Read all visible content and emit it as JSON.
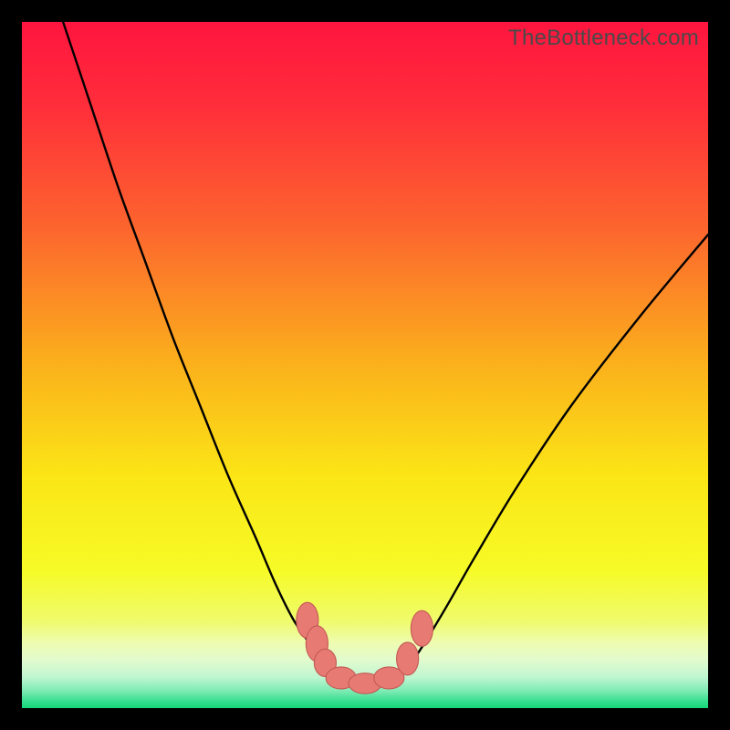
{
  "watermark": "TheBottleneck.com",
  "colors": {
    "frame": "#000000",
    "curve": "#000000",
    "marker_fill": "#e77b74",
    "marker_stroke": "#c45a55",
    "gradient_stops": [
      {
        "offset": 0.0,
        "color": "#ff153f"
      },
      {
        "offset": 0.12,
        "color": "#ff2d3a"
      },
      {
        "offset": 0.3,
        "color": "#fc652e"
      },
      {
        "offset": 0.5,
        "color": "#fbb11c"
      },
      {
        "offset": 0.66,
        "color": "#fbe516"
      },
      {
        "offset": 0.8,
        "color": "#f6fb27"
      },
      {
        "offset": 0.875,
        "color": "#effb6f"
      },
      {
        "offset": 0.905,
        "color": "#eefcb1"
      },
      {
        "offset": 0.93,
        "color": "#e2fbce"
      },
      {
        "offset": 0.955,
        "color": "#bff6d1"
      },
      {
        "offset": 0.975,
        "color": "#7eebb4"
      },
      {
        "offset": 0.99,
        "color": "#35df8f"
      },
      {
        "offset": 1.0,
        "color": "#15d877"
      }
    ]
  },
  "chart_data": {
    "type": "line",
    "title": "",
    "xlabel": "",
    "ylabel": "",
    "xlim": [
      0,
      100
    ],
    "ylim": [
      0,
      100
    ],
    "grid": false,
    "series": [
      {
        "name": "bottleneck-curve",
        "x": [
          6,
          10,
          14,
          18,
          22,
          26,
          30,
          34,
          37,
          39.5,
          41.5,
          43,
          45,
          47,
          50,
          53,
          55,
          57,
          59,
          62,
          66,
          72,
          80,
          90,
          100
        ],
        "y": [
          100,
          88,
          76,
          65,
          54,
          44,
          34,
          25,
          18,
          13,
          10,
          7.5,
          5.2,
          4.0,
          3.5,
          4.0,
          5.0,
          7.0,
          10,
          15,
          22,
          32,
          44,
          57,
          69
        ]
      }
    ],
    "markers": [
      {
        "x": 41.6,
        "y": 12.8,
        "rx": 1.6,
        "ry": 2.6
      },
      {
        "x": 43.0,
        "y": 9.4,
        "rx": 1.6,
        "ry": 2.6
      },
      {
        "x": 44.2,
        "y": 6.6,
        "rx": 1.6,
        "ry": 2.0
      },
      {
        "x": 46.5,
        "y": 4.4,
        "rx": 2.2,
        "ry": 1.6
      },
      {
        "x": 50.0,
        "y": 3.6,
        "rx": 2.4,
        "ry": 1.5
      },
      {
        "x": 53.5,
        "y": 4.4,
        "rx": 2.2,
        "ry": 1.6
      },
      {
        "x": 56.2,
        "y": 7.2,
        "rx": 1.6,
        "ry": 2.4
      },
      {
        "x": 58.3,
        "y": 11.6,
        "rx": 1.6,
        "ry": 2.6
      }
    ]
  }
}
